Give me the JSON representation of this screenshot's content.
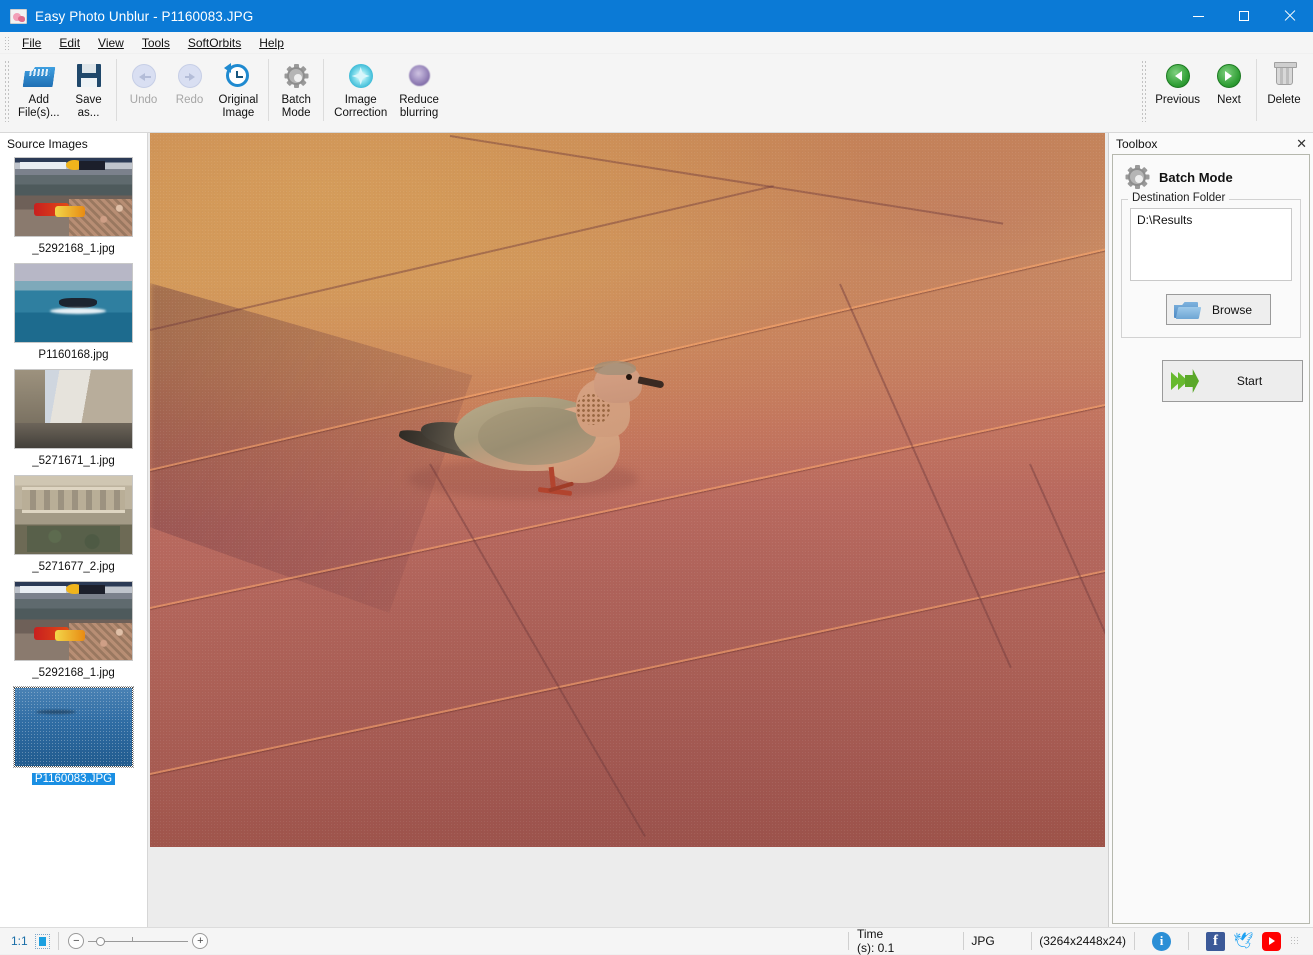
{
  "window": {
    "title": "Easy Photo Unblur - P1160083.JPG",
    "icon": "app-icon",
    "minimize": "–",
    "maximize": "☐",
    "close": "×"
  },
  "menubar": {
    "items": [
      {
        "label": "File"
      },
      {
        "label": "Edit"
      },
      {
        "label": "View"
      },
      {
        "label": "Tools"
      },
      {
        "label": "SoftOrbits"
      },
      {
        "label": "Help"
      }
    ]
  },
  "toolbar": {
    "left_buttons": [
      {
        "name": "add-files",
        "line1": "Add",
        "line2": "File(s)...",
        "icon": "folder-add-icon",
        "disabled": false
      },
      {
        "name": "save-as",
        "line1": "Save",
        "line2": "as...",
        "icon": "floppy-disk-icon",
        "disabled": false
      },
      {
        "name": "undo",
        "line1": "Undo",
        "line2": "",
        "icon": "undo-arrow-icon",
        "disabled": true
      },
      {
        "name": "redo",
        "line1": "Redo",
        "line2": "",
        "icon": "redo-arrow-icon",
        "disabled": true
      },
      {
        "name": "original-image",
        "line1": "Original",
        "line2": "Image",
        "icon": "clock-revert-icon",
        "disabled": false
      },
      {
        "name": "batch-mode",
        "line1": "Batch",
        "line2": "Mode",
        "icon": "gear-icon",
        "disabled": false
      },
      {
        "name": "image-correction",
        "line1": "Image",
        "line2": "Correction",
        "icon": "starburst-icon",
        "disabled": false
      },
      {
        "name": "reduce-blurring",
        "line1": "Reduce",
        "line2": "blurring",
        "icon": "blur-circle-icon",
        "disabled": false
      }
    ],
    "right_buttons": [
      {
        "name": "previous",
        "line1": "Previous",
        "line2": "",
        "icon": "green-left-arrow-icon"
      },
      {
        "name": "next",
        "line1": "Next",
        "line2": "",
        "icon": "green-right-arrow-icon"
      },
      {
        "name": "delete",
        "line1": "Delete",
        "line2": "",
        "icon": "trash-icon"
      }
    ],
    "overflow": "▾"
  },
  "sidebar": {
    "header": "Source Images",
    "items": [
      {
        "label": "_5292168_1.jpg",
        "art": "t-f1",
        "selected": false
      },
      {
        "label": "P1160168.jpg",
        "art": "t-boat",
        "selected": false
      },
      {
        "label": "_5271671_1.jpg",
        "art": "t-street",
        "selected": false
      },
      {
        "label": "_5271677_2.jpg",
        "art": "t-arch",
        "selected": false
      },
      {
        "label": "_5292168_1.jpg",
        "art": "t-f1",
        "selected": false
      },
      {
        "label": "P1160083.JPG",
        "art": "t-sel",
        "selected": true
      }
    ]
  },
  "toolbox": {
    "title": "Toolbox",
    "close": "✕",
    "panel_title": "Batch Mode",
    "panel_icon": "gear-icon",
    "destination_legend": "Destination Folder",
    "destination_value": "D:\\Results",
    "browse_label": "Browse",
    "browse_icon": "folder-open-icon",
    "start_label": "Start",
    "start_icon": "green-arrow-icon"
  },
  "statusbar": {
    "zoom_ratio": "1:1",
    "fit_icon": "fit-to-screen-icon",
    "zoom_out": "−",
    "zoom_in": "+",
    "time": "Time (s): 0.1",
    "format": "JPG",
    "dimensions": "(3264x2448x24)",
    "socials": [
      {
        "name": "info-icon",
        "glyph": "i"
      },
      {
        "name": "facebook-icon",
        "glyph": "f"
      },
      {
        "name": "twitter-icon",
        "glyph": "🕊"
      },
      {
        "name": "youtube-icon",
        "glyph": ""
      }
    ]
  },
  "colors": {
    "titlebar": "#0b7ad6",
    "accent": "#1a8fe3",
    "toolbar_bg": "#f5f5f5",
    "canvas_bg": "#ececec",
    "selection": "#1a8fe3"
  }
}
